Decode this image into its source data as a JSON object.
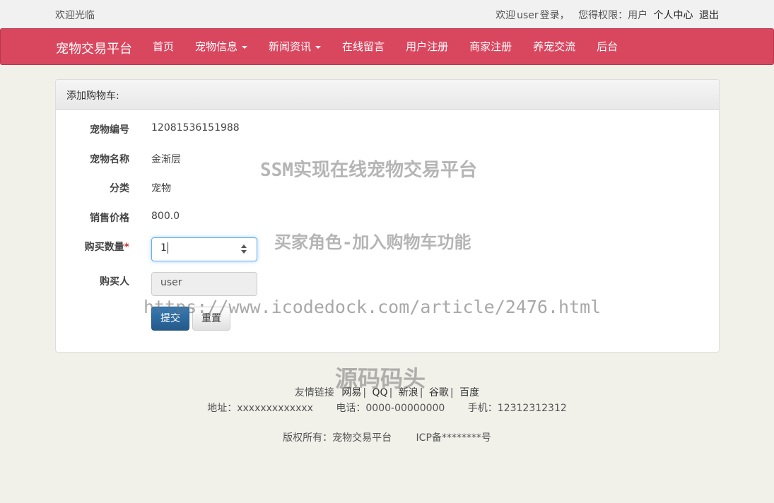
{
  "topbar": {
    "welcome": "欢迎光临",
    "user_prefix": "欢迎",
    "username": "user",
    "logged_in": "登录，",
    "permission": "您得权限：用户",
    "profile_link": "个人中心",
    "logout_link": "退出"
  },
  "navbar": {
    "brand": "宠物交易平台",
    "items": [
      {
        "label": "首页",
        "dropdown": false
      },
      {
        "label": "宠物信息",
        "dropdown": true
      },
      {
        "label": "新闻资讯",
        "dropdown": true
      },
      {
        "label": "在线留言",
        "dropdown": false
      },
      {
        "label": "用户注册",
        "dropdown": false
      },
      {
        "label": "商家注册",
        "dropdown": false
      },
      {
        "label": "养宠交流",
        "dropdown": false
      },
      {
        "label": "后台",
        "dropdown": false
      }
    ],
    "color": "#d9475f"
  },
  "panel": {
    "title": "添加购物车:",
    "fields": {
      "pet_id_label": "宠物编号",
      "pet_id_value": "12081536151988",
      "pet_name_label": "宠物名称",
      "pet_name_value": "金渐层",
      "category_label": "分类",
      "category_value": "宠物",
      "price_label": "销售价格",
      "price_value": "800.0",
      "quantity_label": "购买数量",
      "quantity_required": "*",
      "quantity_value": "1",
      "buyer_label": "购买人",
      "buyer_value": "user"
    },
    "submit_label": "提交",
    "reset_label": "重置"
  },
  "watermarks": {
    "title": "SSM实现在线宠物交易平台",
    "subtitle": "买家角色-加入购物车功能",
    "url": "https://www.icodedock.com/article/2476.html",
    "source": "源码码头"
  },
  "footer": {
    "links_label": "友情链接",
    "links": [
      "网易",
      "QQ",
      "新浪",
      "谷歌",
      "百度"
    ],
    "address": "地址：xxxxxxxxxxxxx",
    "phone": "电话：0000-00000000",
    "mobile": "手机：12312312312",
    "copyright": "版权所有：宠物交易平台",
    "icp": "ICP备********号"
  }
}
